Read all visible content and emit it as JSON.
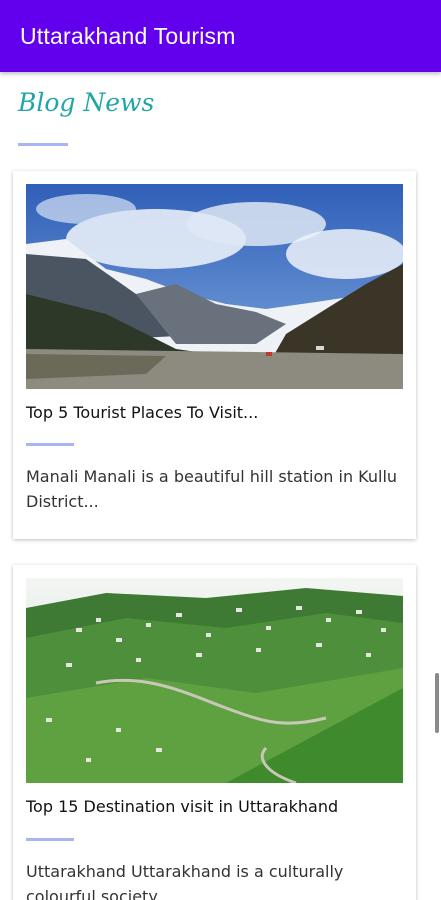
{
  "app": {
    "title": "Uttarakhand Tourism",
    "accent": "#6200ee"
  },
  "section": {
    "heading": "Blog News",
    "heading_color": "#22a5a8"
  },
  "posts": [
    {
      "image": "mountain-valley-photo",
      "title": "Top 5 Tourist Places To Visit...",
      "excerpt": "Manali Manali is a beautiful hill station in Kullu District..."
    },
    {
      "image": "green-hill-town-photo",
      "title": "Top 15 Destination visit in Uttarakhand",
      "excerpt": "Uttarakhand  Uttarakhand is a culturally colourful society..."
    }
  ]
}
